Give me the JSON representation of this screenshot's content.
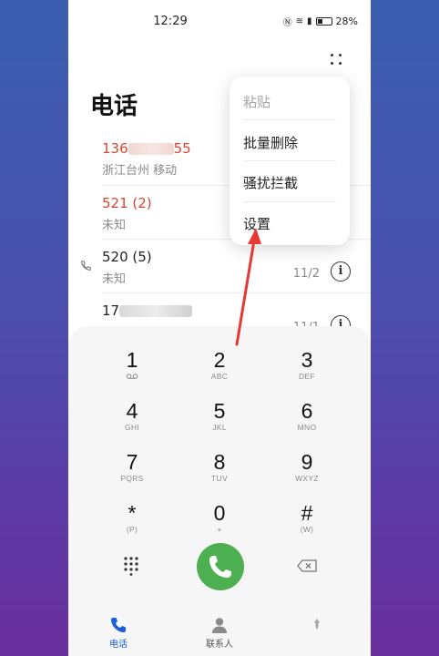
{
  "status_bar": {
    "time": "12:29",
    "battery": "28%"
  },
  "header": {
    "title": "电话"
  },
  "calls": [
    {
      "number_visible_prefix": "136",
      "number_visible_suffix": "55",
      "subtitle": "浙江台州 移动",
      "date": "",
      "missed": true
    },
    {
      "number": "521 (2)",
      "subtitle": "未知",
      "date": "",
      "missed": true
    },
    {
      "number": "520 (5)",
      "subtitle": "未知",
      "date": "11/2",
      "missed": false
    },
    {
      "number_visible_prefix": "17",
      "subtitle": "",
      "date": "11/1",
      "missed": false
    }
  ],
  "menu": {
    "items": [
      {
        "label": "粘贴",
        "enabled": false
      },
      {
        "label": "批量删除",
        "enabled": true
      },
      {
        "label": "骚扰拦截",
        "enabled": true
      },
      {
        "label": "设置",
        "enabled": true
      }
    ]
  },
  "dialpad": {
    "keys": [
      {
        "digit": "1",
        "letters": ""
      },
      {
        "digit": "2",
        "letters": "ABC"
      },
      {
        "digit": "3",
        "letters": "DEF"
      },
      {
        "digit": "4",
        "letters": "GHI"
      },
      {
        "digit": "5",
        "letters": "JKL"
      },
      {
        "digit": "6",
        "letters": "MNO"
      },
      {
        "digit": "7",
        "letters": "PQRS"
      },
      {
        "digit": "8",
        "letters": "TUV"
      },
      {
        "digit": "9",
        "letters": "WXYZ"
      },
      {
        "digit": "*",
        "letters": "(P)"
      },
      {
        "digit": "0",
        "letters": "+"
      },
      {
        "digit": "#",
        "letters": "(W)"
      }
    ]
  },
  "tabs": [
    {
      "label": "电话",
      "active": true
    },
    {
      "label": "联系人",
      "active": false
    }
  ],
  "colors": {
    "accent": "#1a5fd6",
    "missed": "#d9462f",
    "call_button": "#4caf50",
    "annotation_arrow": "#e53935"
  },
  "icons": [
    "voicemail-icon",
    "phone-icon",
    "contact-icon",
    "more-icon",
    "info-icon",
    "keypad-icon",
    "backspace-icon"
  ]
}
